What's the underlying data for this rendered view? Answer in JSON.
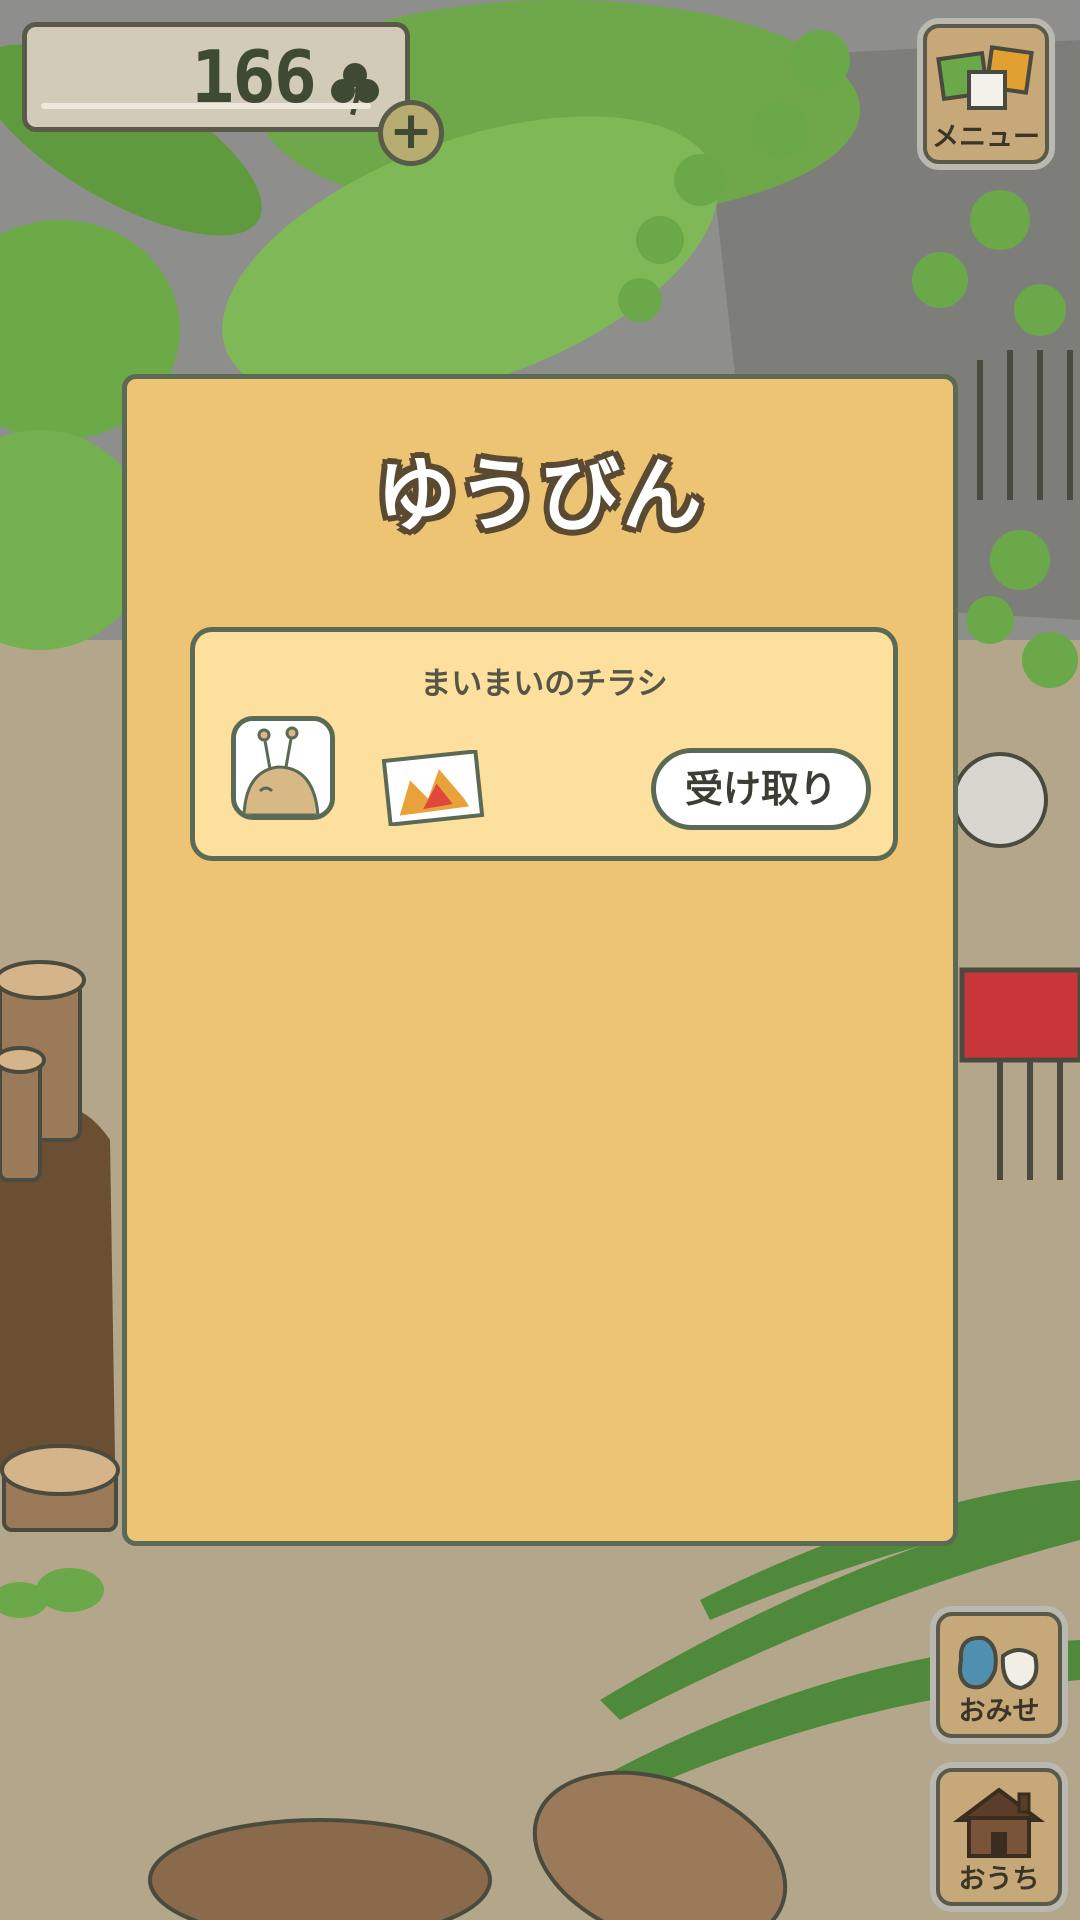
{
  "hud": {
    "clover_count": "166",
    "add_clovers_label": "+"
  },
  "side_menu": {
    "menu_label": "メニュー",
    "shop_label": "おみせ",
    "home_label": "おうち"
  },
  "mail_dialog": {
    "title": "ゆうびん",
    "items": [
      {
        "title": "まいまいのチラシ",
        "sender": "snail",
        "attachment": "flyer",
        "receive_label": "受け取り"
      }
    ]
  },
  "icons": [
    "clover-icon",
    "plus-icon",
    "menu-icon",
    "shop-bag-icon",
    "house-icon",
    "snail-avatar-icon",
    "flyer-icon"
  ],
  "colors": {
    "dialog_bg": "#ecc473",
    "mail_item_bg": "#fde09d",
    "outline": "#5b6a55",
    "leaf_green": "#7cb85a"
  }
}
